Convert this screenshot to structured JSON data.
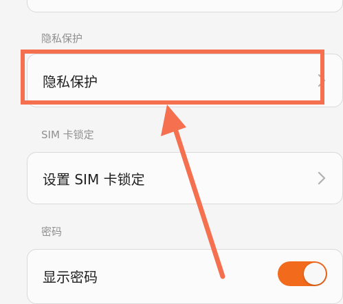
{
  "sections": {
    "privacy_header": "隐私保护",
    "sim_header": "SIM 卡锁定",
    "password_header": "密码"
  },
  "rows": {
    "privacy": "隐私保护",
    "sim_lock": "设置 SIM 卡锁定",
    "show_password": "显示密码"
  },
  "toggle": {
    "show_password_on": true
  },
  "colors": {
    "accent": "#f26b1d",
    "annotation": "#f4704f"
  },
  "icons": {
    "chevron": "chevron-right-icon"
  }
}
